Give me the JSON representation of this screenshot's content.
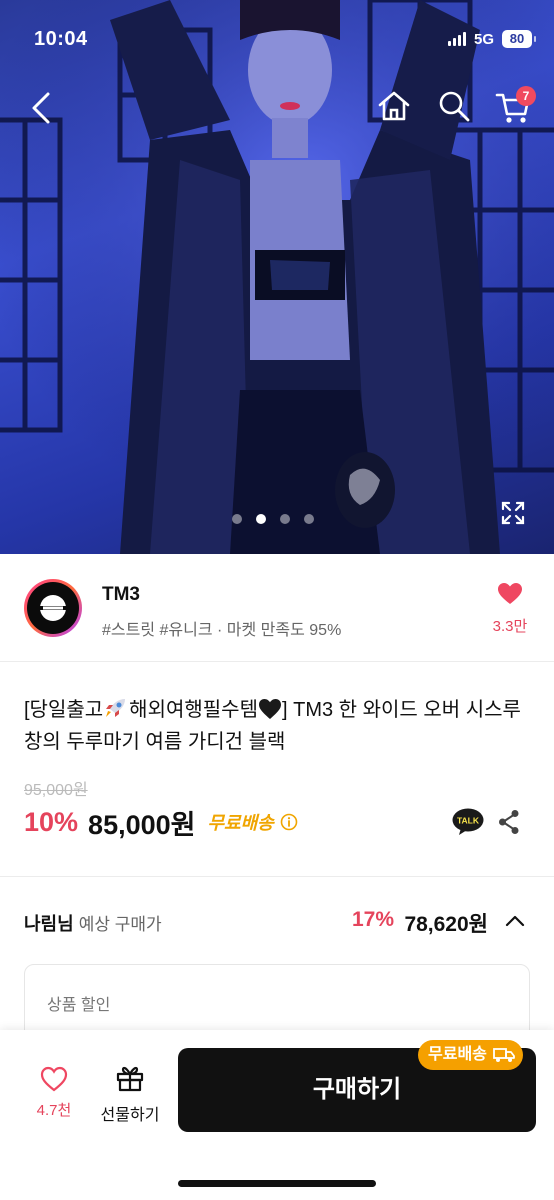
{
  "status_bar": {
    "time": "10:04",
    "network": "5G",
    "battery": "80"
  },
  "nav": {
    "cart_count": "7"
  },
  "gallery": {
    "total_images": 4,
    "active_index": 1
  },
  "seller": {
    "name": "TM3",
    "tags": "#스트릿 #유니크 · 마켓 만족도 95%",
    "like_count": "3.3만"
  },
  "product": {
    "title_part1": "[당일출고",
    "title_part2": "해외여행필수템",
    "title_part3": "] TM3 한 와이드 오버 시스루 창의 두루마기 여름 가디건 블랙",
    "original_price": "95,000원",
    "discount": "10%",
    "price": "85,000원",
    "free_shipping": "무료배송",
    "talk_label": "TALK"
  },
  "expected": {
    "name": "나림님",
    "label": "예상 구매가",
    "discount": "17%",
    "price": "78,620원",
    "box_label": "상품 할인"
  },
  "bottom_bar": {
    "like_count": "4.7천",
    "gift_label": "선물하기",
    "buy_label": "구매하기",
    "free_badge": "무료배송"
  },
  "colors": {
    "accent": "#e5445c",
    "shipping": "#f0a500",
    "buy_button": "#111111"
  }
}
